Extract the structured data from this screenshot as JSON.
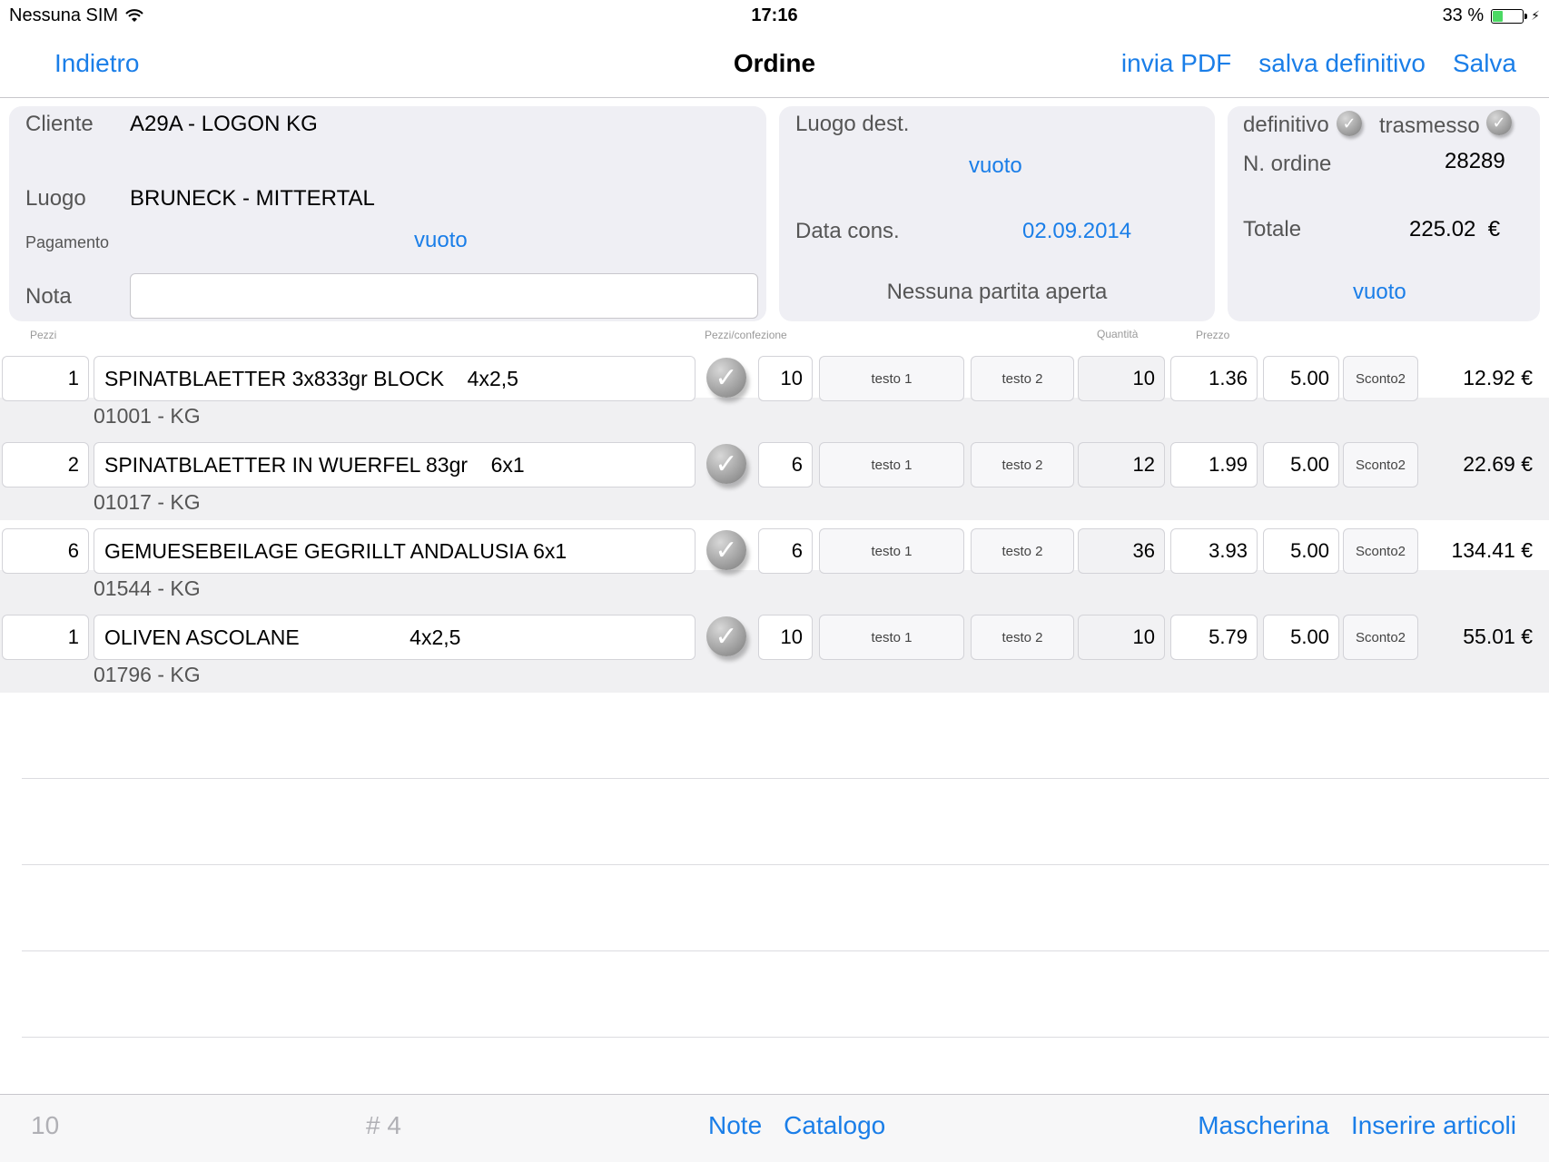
{
  "status_bar": {
    "carrier": "Nessuna SIM",
    "time": "17:16",
    "battery": "33 %",
    "battery_level": 0.33
  },
  "nav": {
    "back": "Indietro",
    "title": "Ordine",
    "actions": [
      "invia PDF",
      "salva definitivo",
      "Salva"
    ]
  },
  "customer": {
    "cliente_label": "Cliente",
    "cliente_value": "A29A - LOGON KG",
    "luogo_label": "Luogo",
    "luogo_value": "BRUNECK - MITTERTAL",
    "pagamento_label": "Pagamento",
    "pagamento_value": "vuoto",
    "nota_label": "Nota",
    "nota_value": ""
  },
  "delivery": {
    "luogo_dest_label": "Luogo dest.",
    "luogo_dest_value": "vuoto",
    "data_cons_label": "Data cons.",
    "data_cons_value": "02.09.2014",
    "partita": "Nessuna partita aperta"
  },
  "summary": {
    "definitivo_label": "definitivo",
    "trasmesso_label": "trasmesso",
    "ordine_label": "N. ordine",
    "ordine_value": "28289",
    "totale_label": "Totale",
    "totale_value": "225.02  €",
    "extra": "vuoto"
  },
  "columns": {
    "pezzi": "Pezzi",
    "pezzi_confezione": "Pezzi/confezione",
    "quantita": "Quantità",
    "prezzo": "Prezzo"
  },
  "items": [
    {
      "pezzi": "1",
      "name": "SPINATBLAETTER 3x833gr BLOCK    4x2,5",
      "code": "01001 - KG",
      "confezione": "10",
      "testo1": "testo 1",
      "testo2": "testo 2",
      "quantita": "10",
      "prezzo": "1.36",
      "sconto": "5.00",
      "sconto2": "Sconto2",
      "totale": "12.92 €"
    },
    {
      "pezzi": "2",
      "name": "SPINATBLAETTER IN WUERFEL 83gr    6x1",
      "code": "01017 - KG",
      "confezione": "6",
      "testo1": "testo 1",
      "testo2": "testo 2",
      "quantita": "12",
      "prezzo": "1.99",
      "sconto": "5.00",
      "sconto2": "Sconto2",
      "totale": "22.69 €"
    },
    {
      "pezzi": "6",
      "name": "GEMUESEBEILAGE GEGRILLT ANDALUSIA 6x1",
      "code": "01544 - KG",
      "confezione": "6",
      "testo1": "testo 1",
      "testo2": "testo 2",
      "quantita": "36",
      "prezzo": "3.93",
      "sconto": "5.00",
      "sconto2": "Sconto2",
      "totale": "134.41 €"
    },
    {
      "pezzi": "1",
      "name": "OLIVEN ASCOLANE                   4x2,5",
      "code": "01796 - KG",
      "confezione": "10",
      "testo1": "testo 1",
      "testo2": "testo 2",
      "quantita": "10",
      "prezzo": "5.79",
      "sconto": "5.00",
      "sconto2": "Sconto2",
      "totale": "55.01 €"
    }
  ],
  "toolbar": {
    "left_value": "10",
    "count": "# 4",
    "note": "Note",
    "catalogo": "Catalogo",
    "mascherina": "Mascherina",
    "inserire": "Inserire articoli"
  },
  "colors": {
    "accent": "#1a7ee8",
    "panel": "#efeff4",
    "row_shade": "#f0f0f2"
  },
  "icons": [
    "wifi-icon",
    "battery-icon",
    "check-icon"
  ]
}
